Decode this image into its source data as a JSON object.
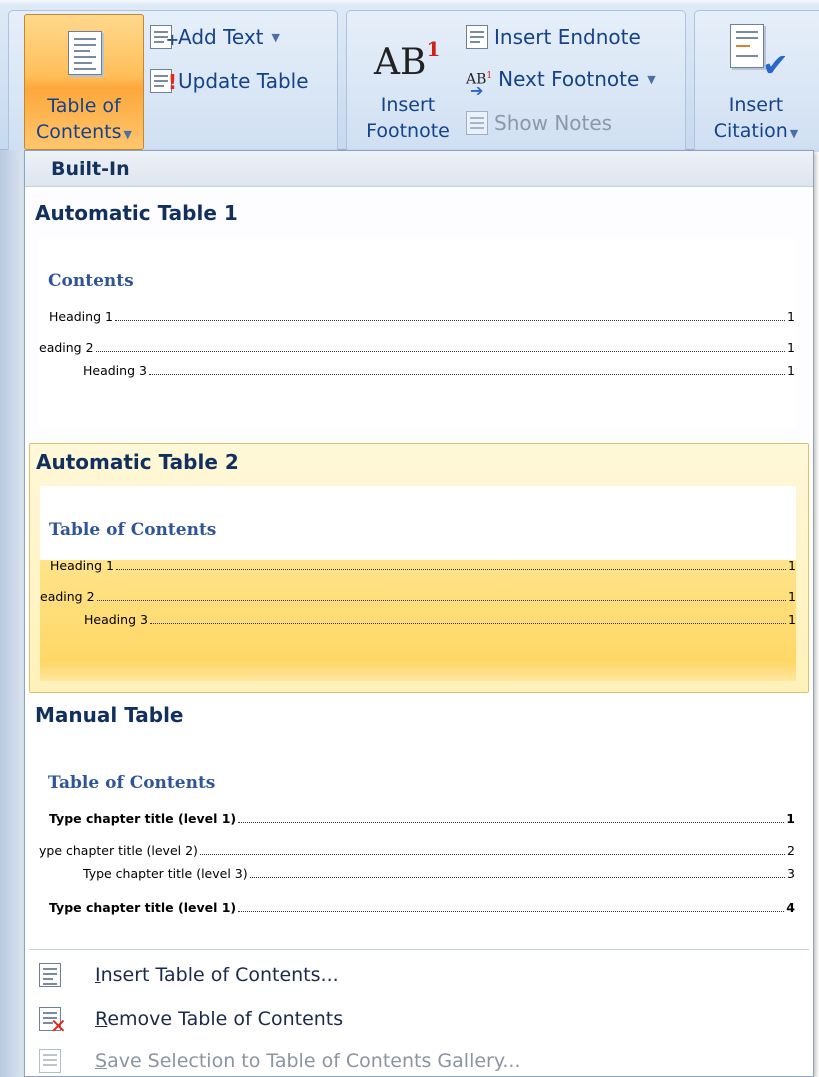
{
  "ribbon": {
    "toc_group": {
      "toc_button_label_line1": "Table of",
      "toc_button_label_line2": "Contents",
      "add_text_label": "Add Text",
      "update_table_label": "Update Table"
    },
    "footnotes_group": {
      "insert_footnote_icon_text": "AB",
      "insert_footnote_icon_sup": "1",
      "insert_footnote_line1": "Insert",
      "insert_footnote_line2": "Footnote",
      "insert_endnote_label": "Insert Endnote",
      "next_footnote_label": "Next Footnote",
      "show_notes_label": "Show Notes"
    },
    "citations_group": {
      "insert_citation_line1": "Insert",
      "insert_citation_line2": "Citation"
    }
  },
  "dropdown": {
    "section_header": "Built-In",
    "items": [
      {
        "title": "Automatic Table 1",
        "preview_title": "Contents",
        "lines": [
          {
            "text": "Heading 1",
            "page": "1"
          },
          {
            "text": "eading 2",
            "page": "1"
          },
          {
            "text": "Heading 3",
            "page": "1"
          }
        ]
      },
      {
        "title": "Automatic Table 2",
        "preview_title": "Table of Contents",
        "lines": [
          {
            "text": "Heading 1",
            "page": "1"
          },
          {
            "text": "eading 2",
            "page": "1"
          },
          {
            "text": "Heading 3",
            "page": "1"
          }
        ]
      },
      {
        "title": "Manual Table",
        "preview_title": "Table of Contents",
        "lines": [
          {
            "text": "Type chapter title (level 1)",
            "page": "1"
          },
          {
            "text": "ype chapter title (level 2)",
            "page": "2"
          },
          {
            "text": "Type chapter title (level 3)",
            "page": "3"
          },
          {
            "text": "Type chapter title (level 1)",
            "page": "4"
          }
        ]
      }
    ],
    "commands": {
      "insert_toc": {
        "accel": "I",
        "rest": "nsert Table of Contents..."
      },
      "remove_toc": {
        "accel": "R",
        "rest": "emove Table of Contents"
      },
      "save_selection": {
        "accel": "S",
        "rest": "ave Selection to Table of Contents Gallery..."
      }
    }
  },
  "colors": {
    "ribbon_bg": "#d2e1f3",
    "active_button": "#ffbf5a",
    "label_blue": "#15428b",
    "highlight_item": "#fff1b9",
    "preview_heading": "#2f5597",
    "delete_red": "#e0261d"
  },
  "icons": [
    "document-lines-icon",
    "add-text-icon",
    "update-table-icon",
    "footnote-ab-icon",
    "insert-endnote-icon",
    "next-footnote-icon",
    "show-notes-icon",
    "citation-check-icon",
    "remove-x-icon",
    "save-selection-icon"
  ]
}
